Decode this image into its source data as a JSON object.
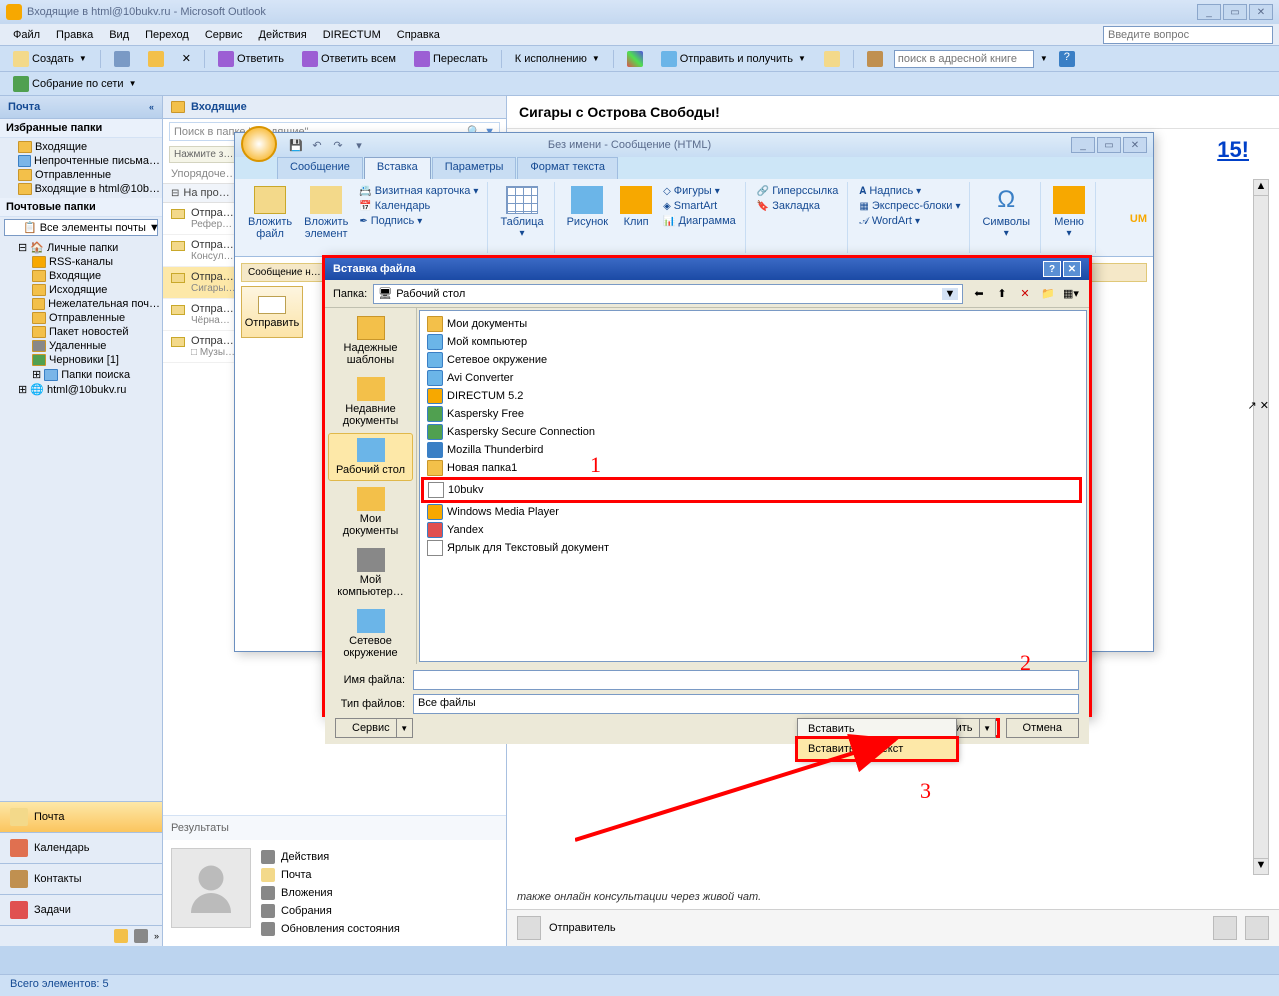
{
  "title": "Входящие в html@10bukv.ru - Microsoft Outlook",
  "menu": [
    "Файл",
    "Правка",
    "Вид",
    "Переход",
    "Сервис",
    "Действия",
    "DIRECTUM",
    "Справка"
  ],
  "question_placeholder": "Введите вопрос",
  "toolbar": {
    "create": "Создать",
    "reply": "Ответить",
    "reply_all": "Ответить всем",
    "forward": "Переслать",
    "execute": "К исполнению",
    "sendrecv": "Отправить и получить",
    "addressbook_ph": "поиск в адресной книге"
  },
  "toolbar2": "Собрание по сети",
  "sidebar": {
    "head": "Почта",
    "fav_hdr": "Избранные папки",
    "fav": [
      "Входящие",
      "Непрочтенные письма…",
      "Отправленные",
      "Входящие в html@10b…"
    ],
    "mail_hdr": "Почтовые папки",
    "all": "Все элементы почты",
    "tree": {
      "root": "Личные папки",
      "items": [
        "RSS-каналы",
        "Входящие",
        "Исходящие",
        "Нежелательная поч…",
        "Отправленные",
        "Пакет новостей",
        "Удаленные",
        "Черновики [1]",
        "Папки поиска"
      ],
      "acct": "html@10bukv.ru"
    },
    "nav": [
      "Почта",
      "Календарь",
      "Контакты",
      "Задачи"
    ]
  },
  "middle": {
    "head": "Входящие",
    "search_ph": "Поиск в папке \"Входящие\"",
    "hint": "Нажмите з…",
    "arrange": "Упорядоче…",
    "groups": {
      "g1": "На про…",
      "g2": "Рефер…"
    },
    "items": [
      {
        "from": "Отпра…",
        "subj": "Консул…"
      },
      {
        "from": "Отпра…",
        "subj": "Сигары…"
      },
      {
        "from": "Отпра…",
        "subj": "Чёрна…"
      },
      {
        "from": "Отпра…",
        "subj": "□ Музы…"
      }
    ],
    "results": "Результаты",
    "details": [
      "Действия",
      "Почта",
      "Вложения",
      "Собрания",
      "Обновления состояния"
    ]
  },
  "reading": {
    "subject": "Сигары с Острова Свободы!",
    "bigtext": "15!",
    "footer": "также онлайн консультации через живой чат.",
    "sender": "Отправитель"
  },
  "status": "Всего элементов: 5",
  "compose": {
    "title": "Без имени - Сообщение (HTML)",
    "tabs": [
      "Сообщение",
      "Вставка",
      "Параметры",
      "Формат текста"
    ],
    "active_tab": 1,
    "ribbon": {
      "attach_file": "Вложить\nфайл",
      "attach_item": "Вложить\nэлемент",
      "bizcard": "Визитная карточка",
      "calendar": "Календарь",
      "signature": "Подпись",
      "table": "Таблица",
      "picture": "Рисунок",
      "clip": "Клип",
      "shapes": "Фигуры",
      "smartart": "SmartArt",
      "chart": "Диаграмма",
      "hyperlink": "Гиперссылка",
      "bookmark": "Закладка",
      "textbox": "Надпись",
      "quickparts": "Экспресс-блоки",
      "wordart": "WordArt",
      "symbols": "Символы",
      "menu": "Меню",
      "um": "UM"
    },
    "msgbar": "Сообщение н…",
    "send": "Отправить"
  },
  "filedlg": {
    "title": "Вставка файла",
    "folder_lbl": "Папка:",
    "folder": "Рабочий стол",
    "places": [
      "Надежные шаблоны",
      "Недавние документы",
      "Рабочий стол",
      "Мои документы",
      "Мой компьютер…",
      "Сетевое окружение"
    ],
    "files": [
      "Мои документы",
      "Мой компьютер",
      "Сетевое окружение",
      "Avi Converter",
      "DIRECTUM 5.2",
      "Kaspersky Free",
      "Kaspersky Secure Connection",
      "Mozilla Thunderbird",
      "Новая папка1",
      "10bukv",
      "Windows Media Player",
      "Yandex",
      "Ярлык для Текстовый документ"
    ],
    "filename_lbl": "Имя файла:",
    "filetype_lbl": "Тип файлов:",
    "filetype": "Все файлы",
    "service": "Сервис",
    "insert": "Вставить",
    "cancel": "Отмена",
    "dd_insert": "Вставить",
    "dd_insert_text": "Вставить как текст"
  },
  "annotations": {
    "a1": "1",
    "a2": "2",
    "a3": "3"
  }
}
